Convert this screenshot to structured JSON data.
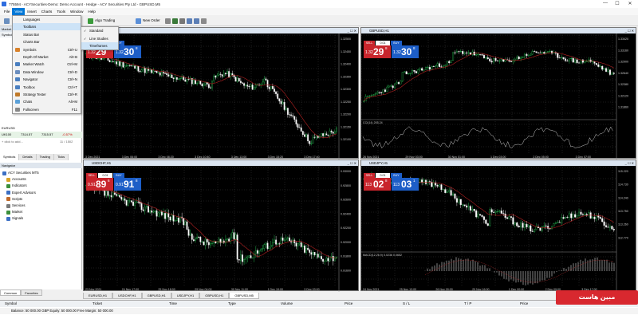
{
  "window": {
    "title": "775594 - ACYSecurities-Demo: Demo Account - Hedge - ACY Securities Pty Ltd - GBPUSD,M5",
    "minimize": "—",
    "maximize": "☐",
    "close": "✕"
  },
  "menu": [
    "File",
    "View",
    "Insert",
    "Charts",
    "Tools",
    "Window",
    "Help"
  ],
  "menu_active": "View",
  "toolbar": {
    "algo_trading": "Algo Trading",
    "new_order": "New Order",
    "languages": "Languages"
  },
  "view_menu": [
    {
      "label": "Languages",
      "shortcut": ""
    },
    {
      "label": "Toolbars",
      "shortcut": ""
    },
    {
      "label": "Status Bar",
      "shortcut": ""
    },
    {
      "label": "Charts Bar",
      "shortcut": ""
    },
    {
      "label": "Symbols",
      "shortcut": "Ctrl+U"
    },
    {
      "label": "Depth Of Market",
      "shortcut": "Alt+B"
    },
    {
      "label": "Market Watch",
      "shortcut": "Ctrl+M"
    },
    {
      "label": "Data Window",
      "shortcut": "Ctrl+D"
    },
    {
      "label": "Navigator",
      "shortcut": "Ctrl+N"
    },
    {
      "label": "Toolbox",
      "shortcut": "Ctrl+T"
    },
    {
      "label": "Strategy Tester",
      "shortcut": "Ctrl+R"
    },
    {
      "label": "Chats",
      "shortcut": "Alt+M"
    },
    {
      "label": "Fullscreen",
      "shortcut": "F11"
    }
  ],
  "toolbars_submenu": [
    "Standard",
    "Line Studies",
    "Timeframes"
  ],
  "market_watch": {
    "header": "Market Watch: 17:30:54",
    "columns": [
      "Symbol",
      "Bid",
      "Ask",
      "Daily Ch..."
    ],
    "rows": [
      {
        "symbol": "EURUSD",
        "bid": "",
        "ask": "",
        "change": ""
      },
      {
        "symbol": "UK100",
        "bid": "7314.57",
        "ask": "7315.57",
        "change": "-0.57%"
      }
    ],
    "add": "+ click to add...",
    "count": "11 / 1502"
  },
  "left_tabs": [
    "Symbols",
    "Details",
    "Trading",
    "Ticks"
  ],
  "navigator": {
    "header": "Navigator",
    "items": [
      "ACY Securities MT5",
      "Accounts",
      "Indicators",
      "Expert Advisors",
      "Scripts",
      "Services",
      "Market",
      "Signals"
    ]
  },
  "bottom_left_tabs": [
    "Common",
    "Favorites"
  ],
  "charts": [
    {
      "tab": "GBPUSD,M5",
      "title": "GBPUSD,M5 · Great Britain Pound vs US Dollar",
      "sell_big": "29",
      "sell_small": "1.32",
      "sell_sup": "8",
      "buy_big": "30",
      "buy_small": "1.32",
      "buy_sup": "8",
      "lot": "0.01",
      "sell": "SELL",
      "buy": "BUY",
      "yticks": [
        "1.32500",
        "1.32450",
        "1.32400",
        "1.32350",
        "1.32300",
        "1.32250",
        "1.32200",
        "1.32150",
        "1.32100"
      ],
      "xticks": [
        "3 Dec 2021",
        "3 Dec 06:00",
        "3 Dec 08:20",
        "3 Dec 10:40",
        "3 Dec 13:00",
        "3 Dec 15:20",
        "3 Dec 17:40"
      ]
    },
    {
      "tab": "GBPUSD,H1",
      "title": "GBPUSD,H1 · Great Britain Pound vs US Dollar",
      "sell_big": "29",
      "sell_small": "1.32",
      "sell_sup": "8",
      "buy_big": "30",
      "buy_small": "1.32",
      "buy_sup": "8",
      "lot": "0.01",
      "sell": "SELL",
      "buy": "BUY",
      "sub": "CCI(14) 205.24",
      "yticks": [
        "1.33420",
        "1.33160",
        "1.32900",
        "1.32640",
        "1.32380",
        "1.32120",
        "1.31860"
      ],
      "xticks": [
        "26 Nov 2021",
        "29 Nov 03:00",
        "30 Nov 01:00",
        "1 Dec 03:00",
        "2 Dec 05:00",
        "3 Dec 07:00"
      ]
    },
    {
      "tab": "USDCHF,H1",
      "title": "USDCHF,H1 · US Dollar vs Swiss Franc",
      "sell_big": "89",
      "sell_small": "0.91",
      "sell_sup": "6",
      "buy_big": "91",
      "buy_small": "0.91",
      "buy_sup": "8",
      "lot": "0.01",
      "sell": "SELL",
      "buy": "BUY",
      "yticks": [
        "0.93000",
        "0.92800",
        "0.92600",
        "0.92400",
        "0.92200",
        "0.92000",
        "0.91800",
        "0.91600"
      ],
      "xticks": [
        "23 Nov 2021",
        "24 Nov 17:00",
        "25 Nov 18:00",
        "29 Nov 04:00",
        "30 Nov 11:00",
        "1 Dec 19:00",
        "3 Dec 03:00"
      ]
    },
    {
      "tab": "USDJPY,H1",
      "title": "USDJPY,H1 · US Dollar vs Japanese Yen",
      "sell_big": "02",
      "sell_small": "113",
      "sell_sup": "8",
      "buy_big": "03",
      "buy_small": "113",
      "buy_sup": "1",
      "lot": "0.01",
      "sell": "SELL",
      "buy": "BUY",
      "sub": "MACD(12,26,9) 0.0236 0.0652",
      "yticks": [
        "115.220",
        "114.730",
        "114.240",
        "113.750",
        "113.260",
        "112.770"
      ],
      "xticks": [
        "24 Nov 2021",
        "25 Nov 13:00",
        "26 Nov 09:00",
        "29 Nov 16:00",
        "1 Dec 00:00",
        "2 Dec 09:00",
        "3 Dec 17:00"
      ]
    }
  ],
  "chart_tabs": [
    "EURUSD,H1",
    "USDCHF,H1",
    "GBPUSD,H1",
    "USDJPY,H1",
    "GBPUSD,H1",
    "GBPUSD,M5"
  ],
  "terminal": {
    "columns": [
      "Symbol",
      "Ticket",
      "Time",
      "Type",
      "Volume",
      "Price",
      "S / L",
      "T / P",
      "Price"
    ],
    "balance": "Balance: 50 000.00 GBP  Equity: 50 000.00  Free Margin: 50 000.00"
  },
  "watermark": "مبین هاست",
  "colors": {
    "bull": "#22b14c",
    "bear": "#e0e0e0",
    "sell": "#c9252c",
    "buy": "#1d5ec7",
    "ma": "#b02020"
  }
}
